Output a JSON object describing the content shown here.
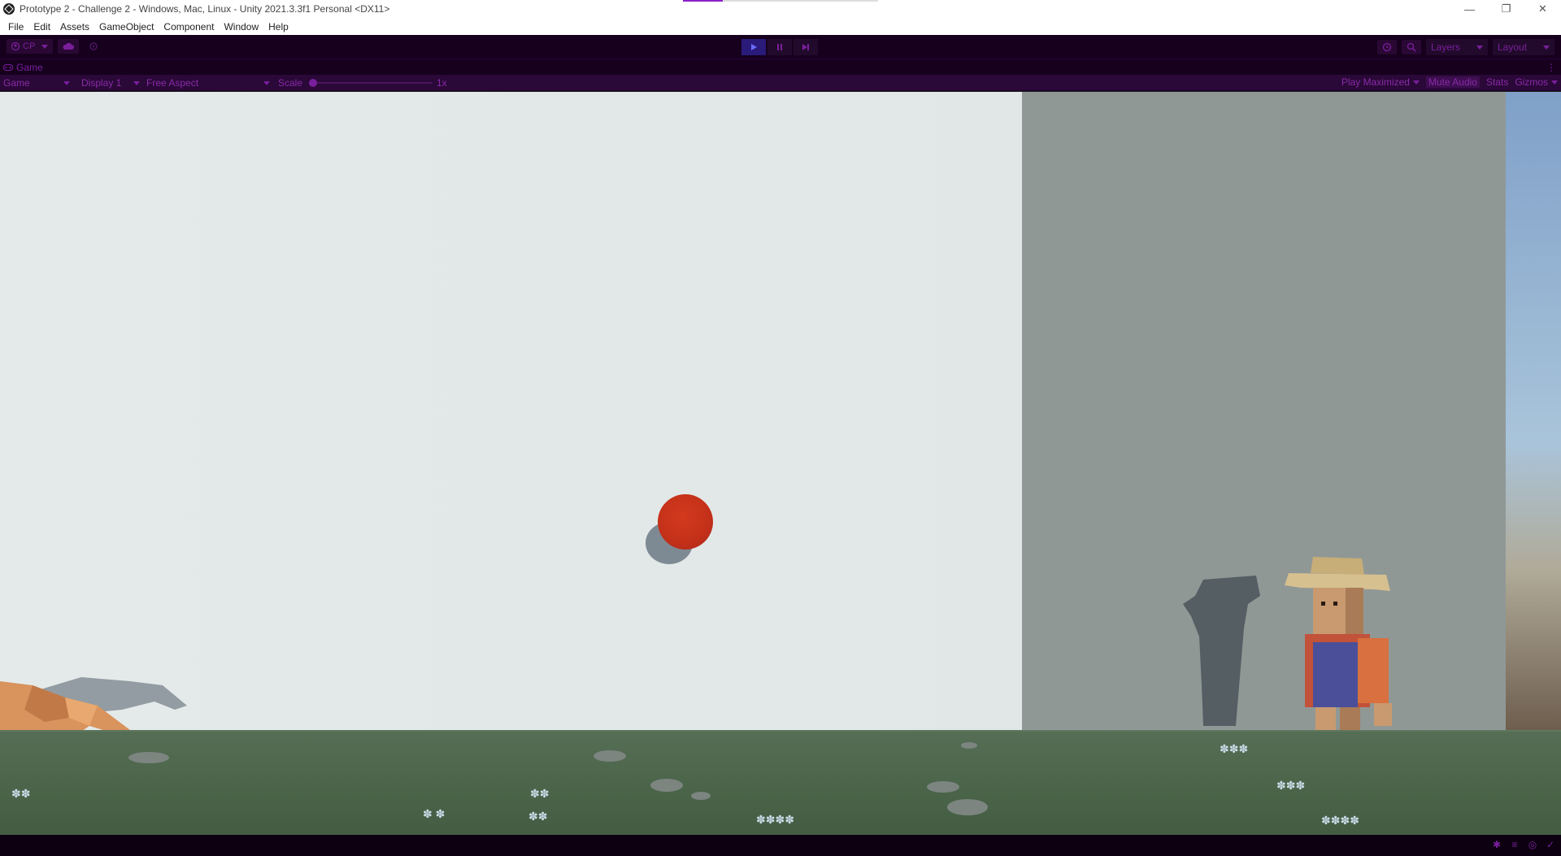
{
  "window": {
    "title": "Prototype 2 - Challenge 2 - Windows, Mac, Linux - Unity 2021.3.3f1 Personal <DX11>",
    "controls": [
      "—",
      "❐",
      "✕"
    ]
  },
  "menu": [
    "File",
    "Edit",
    "Assets",
    "GameObject",
    "Component",
    "Window",
    "Help"
  ],
  "toolbar": {
    "account_label": "CP",
    "layers_label": "Layers",
    "layout_label": "Layout",
    "play_active": true,
    "accent_color": "#7a1f9c"
  },
  "tab": {
    "label": "Game"
  },
  "game_bar": {
    "view_select": "Game",
    "display_select": "Display 1",
    "aspect_select": "Free Aspect",
    "scale_label": "Scale",
    "scale_value": "1x",
    "play_mode_select": "Play Maximized",
    "mute_audio": "Mute Audio",
    "stats": "Stats",
    "gizmos": "Gizmos"
  },
  "scene": {
    "ball_color": "#c3301a",
    "ground_color": "#4a6449"
  }
}
